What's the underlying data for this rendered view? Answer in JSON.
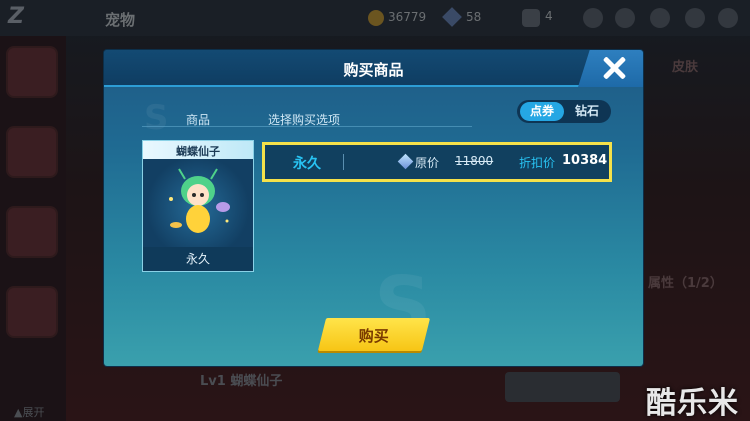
{
  "background": {
    "page_title": "宠物",
    "coins": "36779",
    "gems": "58",
    "tickets": "4",
    "bottom_level": "Lv1",
    "bottom_name": "蝴蝶仙子",
    "side_text_1": "皮肤",
    "side_text_2": "属性（1/2）",
    "expand_label": "▲展开"
  },
  "modal": {
    "title": "购买商品",
    "tabs": [
      "商品",
      "选择购买选项"
    ],
    "currency": {
      "active": "点券",
      "inactive": "钻石"
    },
    "item": {
      "name": "蝴蝶仙子",
      "duration": "永久"
    },
    "option": {
      "duration": "永久",
      "original_label": "原价",
      "original_price": "11800",
      "discount_label": "折扣价",
      "discount_price": "10384"
    },
    "buy_label": "购买"
  },
  "watermark": "酷乐米",
  "colors": {
    "accent": "#25a7e4",
    "highlight": "#f5e14a",
    "buy": "#f7c515"
  }
}
